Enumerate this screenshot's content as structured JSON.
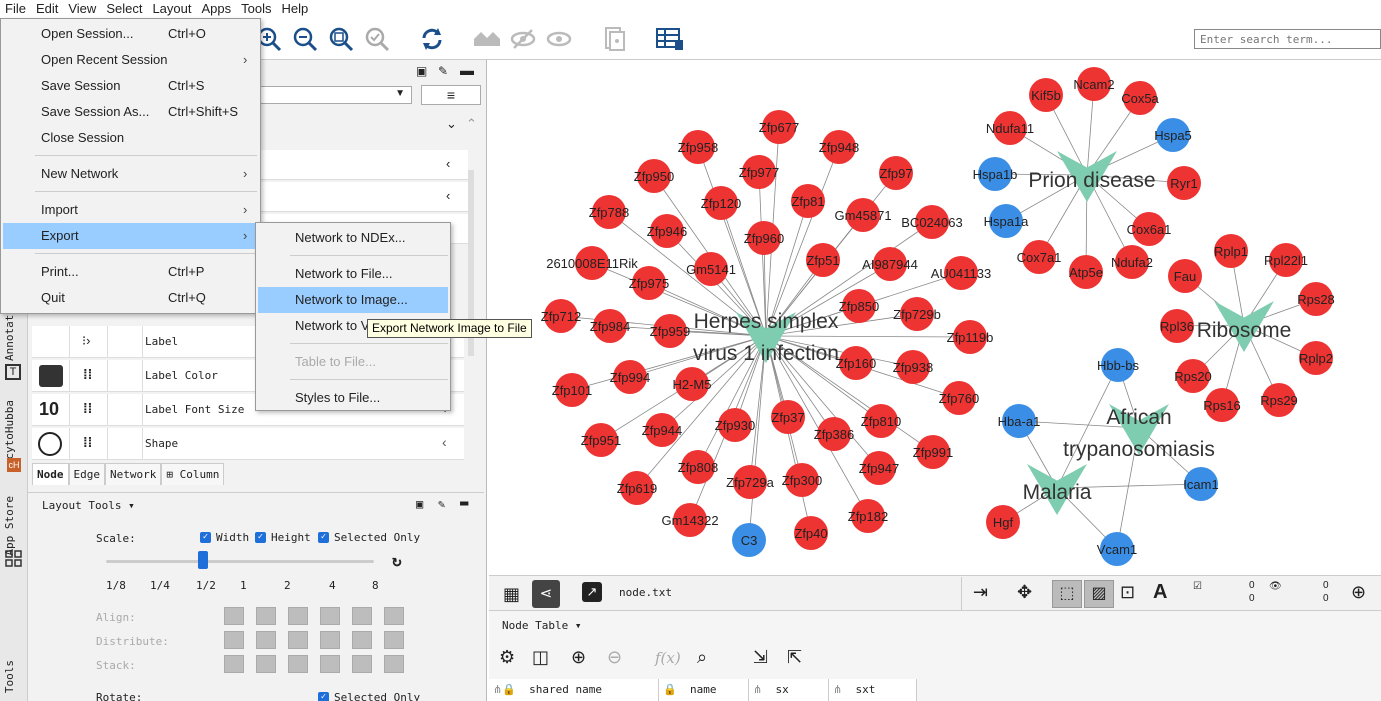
{
  "menubar": [
    "File",
    "Edit",
    "View",
    "Select",
    "Layout",
    "Apps",
    "Tools",
    "Help"
  ],
  "search": {
    "placeholder": "Enter search term..."
  },
  "file_menu": {
    "items": [
      {
        "label": "Open Session...",
        "shortcut": "Ctrl+O",
        "arrow": ""
      },
      {
        "label": "Open Recent Session",
        "shortcut": "",
        "arrow": "›"
      },
      {
        "label": "Save Session",
        "shortcut": "Ctrl+S",
        "arrow": ""
      },
      {
        "label": "Save Session As...",
        "shortcut": "Ctrl+Shift+S",
        "arrow": ""
      },
      {
        "label": "Close Session",
        "shortcut": "",
        "arrow": ""
      },
      {
        "label": "New Network",
        "shortcut": "",
        "arrow": "›"
      },
      {
        "label": "Import",
        "shortcut": "",
        "arrow": "›"
      },
      {
        "label": "Export",
        "shortcut": "",
        "arrow": "›"
      },
      {
        "label": "Print...",
        "shortcut": "Ctrl+P",
        "arrow": ""
      },
      {
        "label": "Quit",
        "shortcut": "Ctrl+Q",
        "arrow": ""
      }
    ]
  },
  "export_menu": {
    "items": [
      {
        "label": "Network to NDEx..."
      },
      {
        "label": "Network to File..."
      },
      {
        "label": "Network to Image..."
      },
      {
        "label": "Network to V"
      },
      {
        "label": "Table to File..."
      },
      {
        "label": "Styles to File..."
      }
    ]
  },
  "tooltip": "Export Network Image to File",
  "style_rows": [
    {
      "label": "Label"
    },
    {
      "label": "Label Color"
    },
    {
      "label": "Label Font Size",
      "value": "10"
    },
    {
      "label": "Shape"
    }
  ],
  "side_tabs": [
    "Annotati",
    "cytoHubba",
    "App Store",
    "Tools"
  ],
  "bottom_tabs": [
    "Node",
    "Edge",
    "Network",
    "Column"
  ],
  "layout_tools": {
    "title": "Layout Tools",
    "scale_label": "Scale:",
    "width": "Width",
    "height": "Height",
    "selected_only": "Selected Only",
    "ticks": [
      "1/8",
      "1/4",
      "1/2",
      "1",
      "2",
      "4",
      "8"
    ],
    "scale_value": "1/2",
    "align": "Align:",
    "distribute": "Distribute:",
    "stack": "Stack:",
    "rotate": "Rotate:"
  },
  "network": {
    "pathways": [
      {
        "label1": "Herpes simplex",
        "label2": "virus 1 infection"
      },
      {
        "label1": "Prion disease",
        "label2": ""
      },
      {
        "label1": "Ribosome",
        "label2": ""
      },
      {
        "label1": "African",
        "label2": "trypanosomiasis"
      },
      {
        "label1": "Malaria",
        "label2": ""
      }
    ],
    "genes": {
      "herpes_red": [
        "Zfp677",
        "Zfp958",
        "Zfp948",
        "Zfp950",
        "Zfp977",
        "Zfp97",
        "Zfp788",
        "Zfp120",
        "Zfp81",
        "Gm45871",
        "BC024063",
        "Zfp946",
        "Zfp960",
        "2610008E11Rik",
        "Gm5141",
        "Zfp51",
        "AI987944",
        "AU041133",
        "Zfp975",
        "Zfp712",
        "Zfp984",
        "Zfp959",
        "Zfp850",
        "Zfp729b",
        "Zfp119b",
        "Zfp160",
        "Zfp938",
        "Zfp101",
        "Zfp994",
        "H2-M5",
        "Zfp760",
        "Zfp37",
        "Zfp810",
        "Zfp951",
        "Zfp944",
        "Zfp930",
        "Zfp386",
        "Zfp991",
        "Zfp808",
        "Zfp947",
        "Zfp619",
        "Zfp729a",
        "Zfp300",
        "Zfp182",
        "Gm14322",
        "Zfp40"
      ],
      "herpes_blue": [
        "C3"
      ],
      "prion_red": [
        "Ncam2",
        "Kif5b",
        "Cox5a",
        "Ndufa11",
        "Ryr1",
        "Cox6a1",
        "Cox7a1",
        "Ndufa2",
        "Atp5e"
      ],
      "prion_blue": [
        "Hspa5",
        "Hspa1b",
        "Hspa1a"
      ],
      "ribo_red": [
        "Rplp1",
        "Rpl22l1",
        "Fau",
        "Rps28",
        "Rpl36",
        "Rplp2",
        "Rps20",
        "Rps16",
        "Rps29"
      ],
      "try_blue": [
        "Hbb-bs",
        "Hba-a1",
        "Icam1",
        "Vcam1"
      ],
      "mal_red": [
        "Hgf"
      ]
    },
    "colors": {
      "red": "#ee3333",
      "blue": "#3b8ee6",
      "pathway": "#7fcdb0"
    }
  },
  "net_toolbar": {
    "network_name": "node.txt",
    "counts": [
      "0",
      "0",
      "0",
      "0"
    ]
  },
  "table": {
    "title": "Node Table",
    "columns": [
      "shared name",
      "name",
      "sx",
      "sxt"
    ]
  }
}
